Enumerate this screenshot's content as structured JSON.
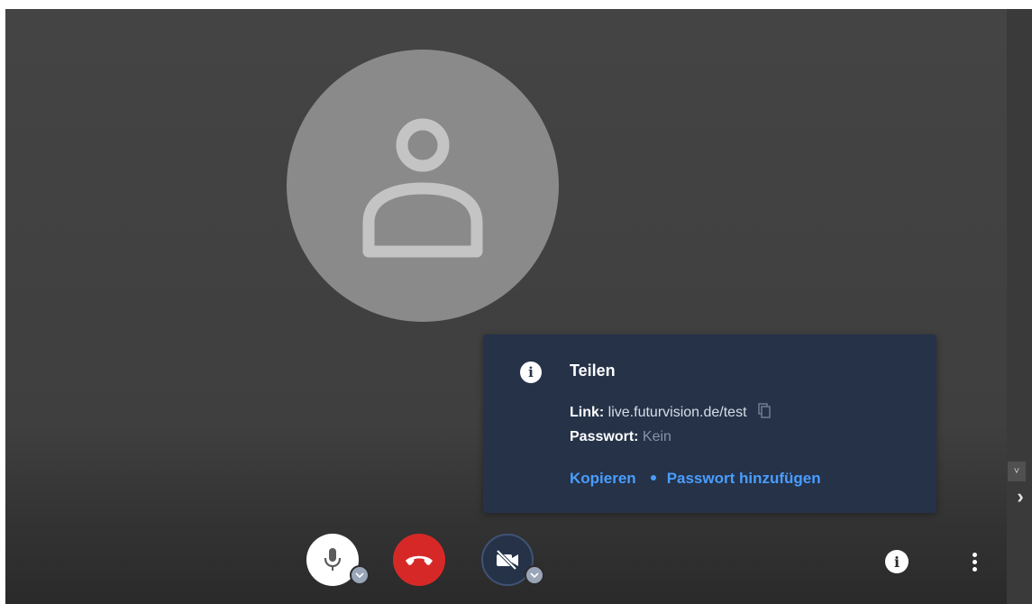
{
  "share_panel": {
    "title": "Teilen",
    "link_label": "Link:",
    "link_value": "live.futurvision.de/test",
    "password_label": "Passwort:",
    "password_value": "Kein",
    "copy_action": "Kopieren",
    "add_password_action": "Passwort hinzufügen"
  },
  "icons": {
    "info": "i",
    "side_toggle": "›",
    "scroll_down": "˅"
  },
  "colors": {
    "panel_bg": "#253248",
    "link_accent": "#4a9dff",
    "hangup_red": "#d72828",
    "avatar_gray": "#8a8a8a"
  }
}
